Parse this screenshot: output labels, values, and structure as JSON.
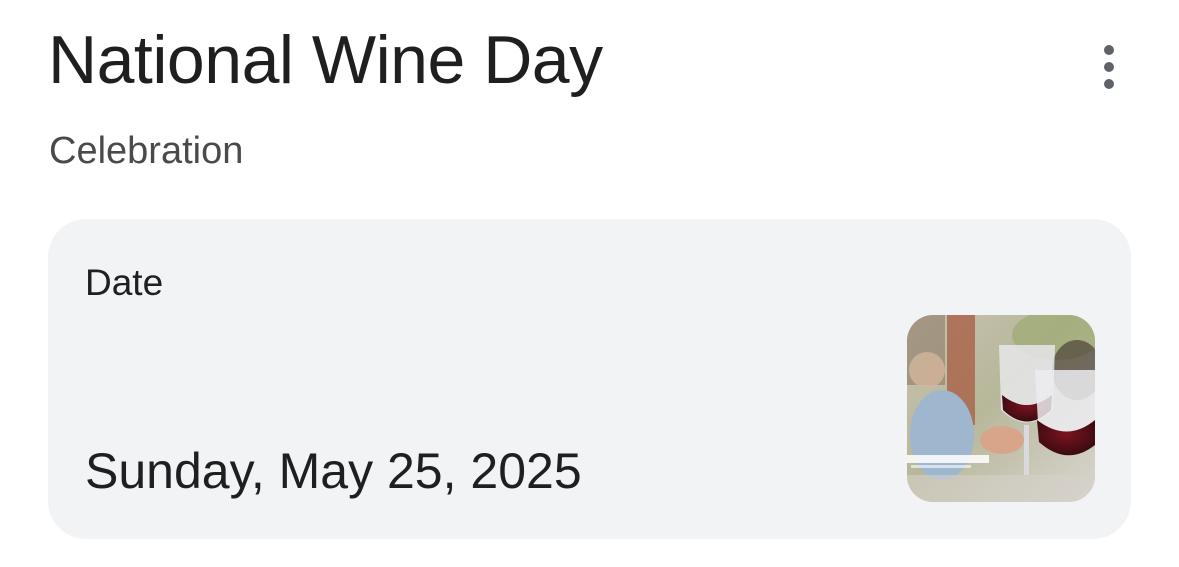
{
  "header": {
    "title": "National Wine Day",
    "subtitle": "Celebration",
    "more_icon": "more-vert-icon"
  },
  "date_card": {
    "label": "Date",
    "value": "Sunday, May 25, 2025",
    "thumbnail_icon": "wine-toast-photo"
  }
}
